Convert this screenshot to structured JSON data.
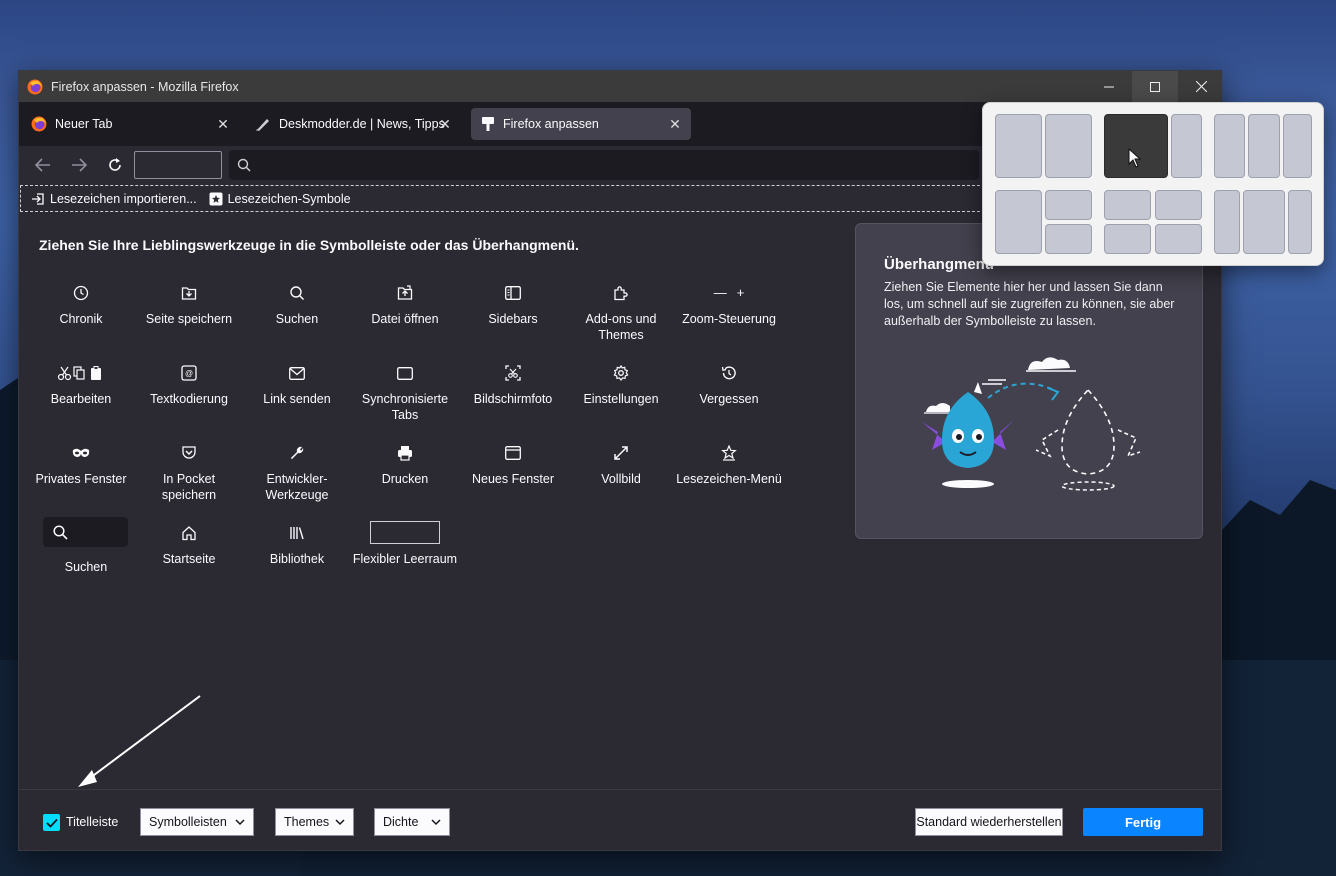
{
  "window": {
    "title": "Firefox anpassen - Mozilla Firefox"
  },
  "tabs": [
    {
      "title": "Neuer Tab",
      "active": false
    },
    {
      "title": "Deskmodder.de | News, Tipps u",
      "active": false
    },
    {
      "title": "Firefox anpassen",
      "active": true
    }
  ],
  "bookmarks": {
    "import_label": "Lesezeichen importieren...",
    "symbols_label": "Lesezeichen-Symbole"
  },
  "customize": {
    "heading": "Ziehen Sie Ihre Lieblingswerkzeuge in die Symbolleiste oder das Überhangmenü.",
    "items": [
      {
        "label": "Chronik",
        "icon": "clock-icon"
      },
      {
        "label": "Seite speichern",
        "icon": "save-page-icon"
      },
      {
        "label": "Suchen",
        "icon": "search-icon"
      },
      {
        "label": "Datei öffnen",
        "icon": "open-file-icon"
      },
      {
        "label": "Sidebars",
        "icon": "sidebar-icon"
      },
      {
        "label": "Add-ons und Themes",
        "icon": "puzzle-icon"
      },
      {
        "label": "Zoom-Steuerung",
        "icon": "zoom-icon"
      },
      {
        "label": "Bearbeiten",
        "icon": "edit-icon"
      },
      {
        "label": "Textkodierung",
        "icon": "text-encoding-icon"
      },
      {
        "label": "Link senden",
        "icon": "mail-icon"
      },
      {
        "label": "Synchronisierte Tabs",
        "icon": "synced-tabs-icon"
      },
      {
        "label": "Bildschirmfoto",
        "icon": "screenshot-icon"
      },
      {
        "label": "Einstellungen",
        "icon": "gear-icon"
      },
      {
        "label": "Vergessen",
        "icon": "forget-icon"
      },
      {
        "label": "Privates Fenster",
        "icon": "private-mask-icon"
      },
      {
        "label": "In Pocket speichern",
        "icon": "pocket-icon"
      },
      {
        "label": "Entwickler-Werkzeuge",
        "icon": "wrench-icon"
      },
      {
        "label": "Drucken",
        "icon": "printer-icon"
      },
      {
        "label": "Neues Fenster",
        "icon": "new-window-icon"
      },
      {
        "label": "Vollbild",
        "icon": "fullscreen-icon"
      },
      {
        "label": "Lesezeichen-Menü",
        "icon": "bookmark-menu-icon"
      },
      {
        "label": "Suchen",
        "icon": "search-icon"
      },
      {
        "label": "Startseite",
        "icon": "home-icon"
      },
      {
        "label": "Bibliothek",
        "icon": "library-icon"
      },
      {
        "label": "Flexibler Leerraum",
        "icon": "flexible-space-icon"
      }
    ],
    "zoom_minus": "—",
    "zoom_plus": "+"
  },
  "overflow": {
    "title": "Überhangmenü",
    "description": "Ziehen Sie Elemente hier her und lassen Sie dann los, um schnell auf sie zugreifen zu können, sie aber außerhalb der Symbolleiste zu lassen."
  },
  "footer": {
    "titlebar_label": "Titelleiste",
    "titlebar_checked": true,
    "toolbars_label": "Symbolleisten",
    "themes_label": "Themes",
    "density_label": "Dichte",
    "reset_label": "Standard wiederherstellen",
    "done_label": "Fertig"
  },
  "colors": {
    "accent": "#0a84ff",
    "checkbox": "#00ddff",
    "background": "#2b2a33"
  }
}
